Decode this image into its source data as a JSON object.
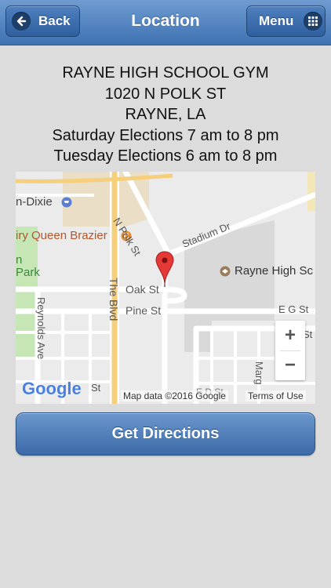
{
  "header": {
    "title": "Location",
    "back_label": "Back",
    "menu_label": "Menu"
  },
  "address": {
    "name": "RAYNE HIGH SCHOOL GYM",
    "street": "1020 N POLK ST",
    "city": "RAYNE, LA",
    "hours": [
      "Saturday Elections 7 am to 8 pm",
      "Tuesday Elections 6 am to 8 pm"
    ]
  },
  "map": {
    "labels": {
      "store": "n-Dixie",
      "restaurant": "iry Queen Brazier",
      "park_line1": "n",
      "park_line2": "Park",
      "polk": "N Polk St",
      "stadium": "Stadium Dr",
      "school": "Rayne High Sc",
      "oak": "Oak St",
      "pine": "Pine St",
      "eg": "E G St",
      "st_right": "St",
      "blvd": "The Blvd",
      "reynolds": "Reynolds Ave",
      "marg": "Marg",
      "st_bottom": "St",
      "efd": "E D St"
    },
    "zoom_in": "+",
    "zoom_out": "−",
    "attribution": "Map data ©2016 Google",
    "terms": "Terms of Use",
    "logo": "Google"
  },
  "directions_label": "Get Directions",
  "colors": {
    "header": "#4a7fbf",
    "pin": "#e53935",
    "highway": "#f7d37e",
    "park": "#c7e6b5"
  }
}
